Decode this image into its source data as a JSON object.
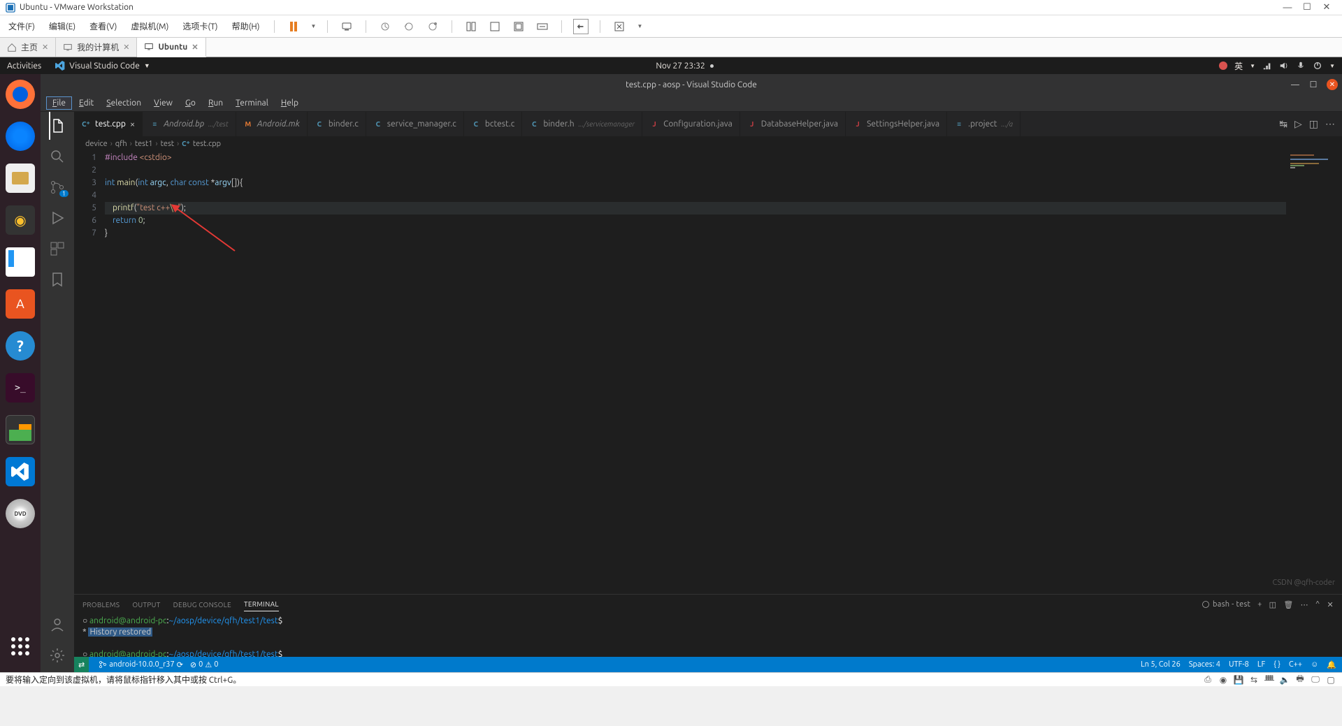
{
  "vmware": {
    "title": "Ubuntu - VMware Workstation",
    "menu": [
      "文件(F)",
      "编辑(E)",
      "查看(V)",
      "虚拟机(M)",
      "选项卡(T)",
      "帮助(H)"
    ],
    "tabs": {
      "home": "主页",
      "mycomputer": "我的计算机",
      "ubuntu": "Ubuntu"
    },
    "status_hint": "要将输入定向到该虚拟机，请将鼠标指针移入其中或按 Ctrl+G。"
  },
  "ubuntu_top": {
    "activities": "Activities",
    "app": "Visual Studio Code",
    "clock": "Nov 27  23:32",
    "lang": "英"
  },
  "vscode": {
    "title": "test.cpp - aosp - Visual Studio Code",
    "menu": [
      "File",
      "Edit",
      "Selection",
      "View",
      "Go",
      "Run",
      "Terminal",
      "Help"
    ],
    "tabs": [
      {
        "icon": "cpp",
        "label": "test.cpp",
        "close": true,
        "active": true,
        "iconText": "C⁺"
      },
      {
        "icon": "bp",
        "label": "Android.bp",
        "suffix": ".../test",
        "iconText": "≡",
        "italic": true
      },
      {
        "icon": "mk",
        "label": "Android.mk",
        "iconText": "M",
        "italic": true
      },
      {
        "icon": "c",
        "label": "binder.c",
        "iconText": "C"
      },
      {
        "icon": "c",
        "label": "service_manager.c",
        "iconText": "C"
      },
      {
        "icon": "c",
        "label": "bctest.c",
        "iconText": "C"
      },
      {
        "icon": "c",
        "label": "binder.h",
        "suffix": ".../servicemanager",
        "iconText": "C"
      },
      {
        "icon": "java",
        "label": "Configuration.java",
        "iconText": "J"
      },
      {
        "icon": "java",
        "label": "DatabaseHelper.java",
        "iconText": "J"
      },
      {
        "icon": "java",
        "label": "SettingsHelper.java",
        "iconText": "J"
      },
      {
        "icon": "proj",
        "label": ".project",
        "suffix": ".../a",
        "iconText": "≡"
      }
    ],
    "breadcrumbs": [
      "device",
      "qfh",
      "test1",
      "test",
      "test.cpp"
    ],
    "code": {
      "lines": [
        {
          "n": 1,
          "raw": "#include <cstdio>"
        },
        {
          "n": 2,
          "raw": ""
        },
        {
          "n": 3,
          "raw": "int main(int argc, char const *argv[]){"
        },
        {
          "n": 4,
          "raw": ""
        },
        {
          "n": 5,
          "raw": "    printf(\"test c++\\n\");"
        },
        {
          "n": 6,
          "raw": "    return 0;"
        },
        {
          "n": 7,
          "raw": "}"
        }
      ]
    },
    "panel": {
      "tabs": [
        "PROBLEMS",
        "OUTPUT",
        "DEBUG CONSOLE",
        "TERMINAL"
      ],
      "active": "TERMINAL",
      "shell_label": "bash - test",
      "term_lines": [
        {
          "prompt": "android@android-pc",
          "colon": ":",
          "path": "~/aosp/device/qfh/test1/test",
          "dollar": "$"
        },
        {
          "history": " * ",
          "history2": " History restored "
        },
        {
          "spacer": true
        },
        {
          "prompt": "android@android-pc",
          "colon": ":",
          "path": "~/aosp/device/qfh/test1/test",
          "dollar": "$"
        }
      ]
    },
    "status": {
      "remote": "⇄",
      "branch": "android-10.0.0_r37",
      "sync": "⟳",
      "errors": "0",
      "warnings": "0",
      "lncol": "Ln 5, Col 26",
      "spaces": "Spaces: 4",
      "encoding": "UTF-8",
      "eol": "LF",
      "lang": "C++",
      "brackets": "{ }"
    }
  },
  "watermark": "CSDN @qfh-coder"
}
